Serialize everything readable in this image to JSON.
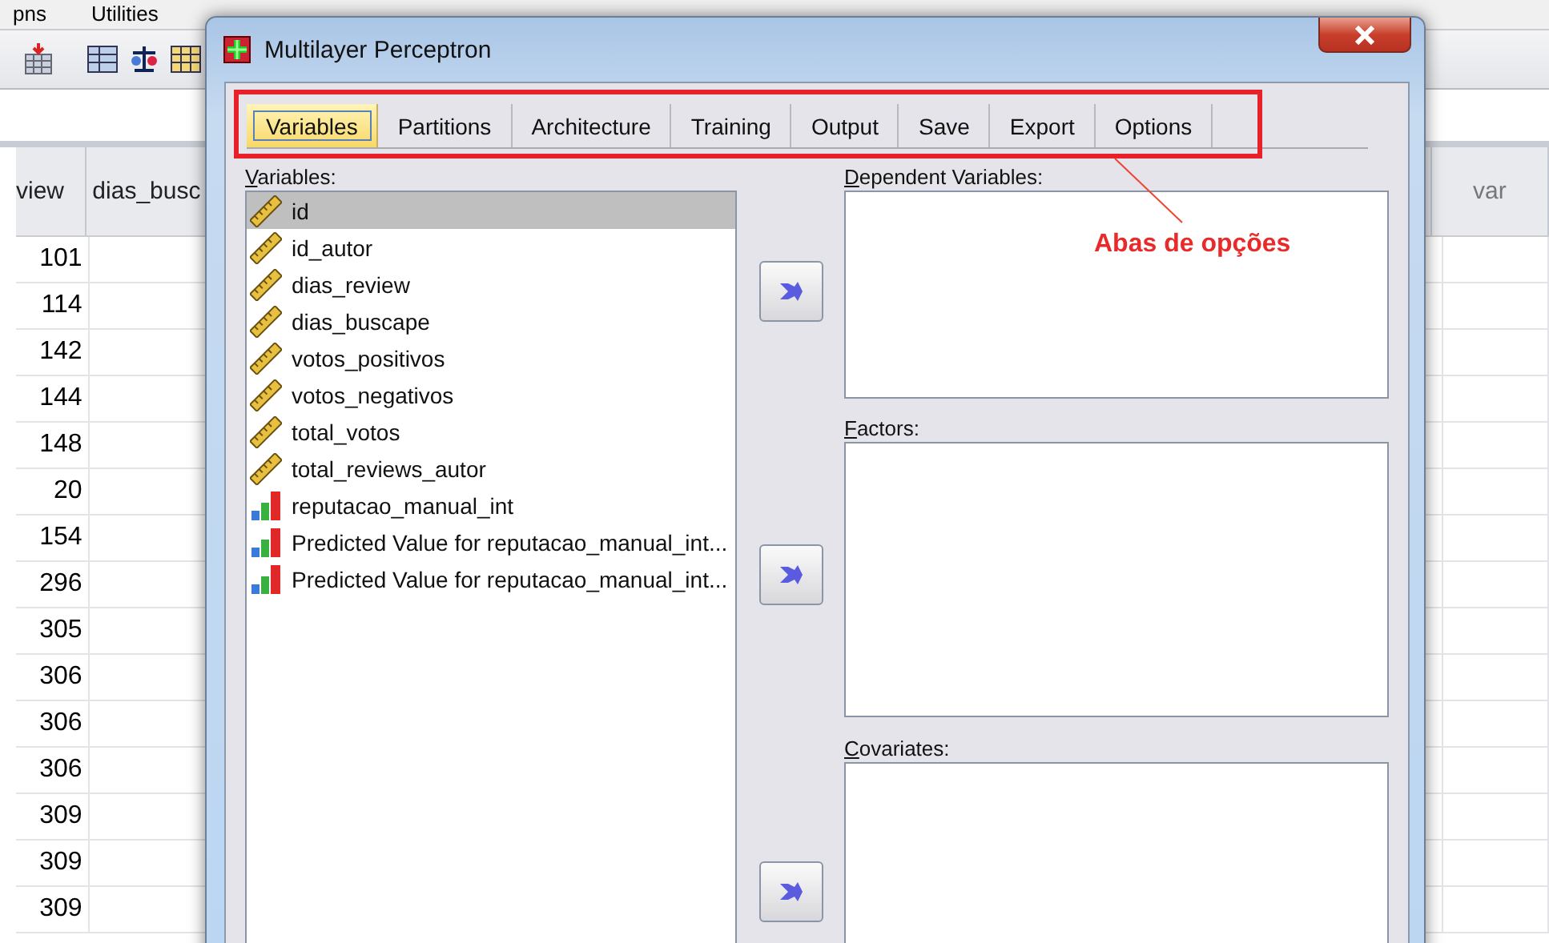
{
  "app_menu": [
    "pns",
    "Utilities"
  ],
  "grid": {
    "columns": [
      "view",
      "dias_busc"
    ],
    "rows": [
      "101",
      "114",
      "142",
      "144",
      "148",
      "20",
      "154",
      "296",
      "305",
      "306",
      "306",
      "306",
      "309",
      "309",
      "309"
    ],
    "right_columns": [
      "var"
    ]
  },
  "dialog": {
    "title": "Multilayer Perceptron",
    "tabs": [
      {
        "label": "Variables",
        "selected": true
      },
      {
        "label": "Partitions",
        "selected": false
      },
      {
        "label": "Architecture",
        "selected": false
      },
      {
        "label": "Training",
        "selected": false
      },
      {
        "label": "Output",
        "selected": false
      },
      {
        "label": "Save",
        "selected": false
      },
      {
        "label": "Export",
        "selected": false
      },
      {
        "label": "Options",
        "selected": false
      }
    ],
    "variables_label": "Variables:",
    "variables": [
      {
        "name": "id",
        "kind": "scale",
        "selected": true
      },
      {
        "name": "id_autor",
        "kind": "scale",
        "selected": false
      },
      {
        "name": "dias_review",
        "kind": "scale",
        "selected": false
      },
      {
        "name": "dias_buscape",
        "kind": "scale",
        "selected": false
      },
      {
        "name": "votos_positivos",
        "kind": "scale",
        "selected": false
      },
      {
        "name": "votos_negativos",
        "kind": "scale",
        "selected": false
      },
      {
        "name": "total_votos",
        "kind": "scale",
        "selected": false
      },
      {
        "name": "total_reviews_autor",
        "kind": "scale",
        "selected": false
      },
      {
        "name": "reputacao_manual_int",
        "kind": "nominal",
        "selected": false
      },
      {
        "name": "Predicted Value for reputacao_manual_int...",
        "kind": "nominal",
        "selected": false
      },
      {
        "name": "Predicted Value for reputacao_manual_int...",
        "kind": "nominal",
        "selected": false
      }
    ],
    "target_lists": [
      {
        "label": "Dependent Variables:"
      },
      {
        "label": "Factors:"
      },
      {
        "label": "Covariates:"
      }
    ]
  },
  "annotation": {
    "text": "Abas de opções"
  }
}
